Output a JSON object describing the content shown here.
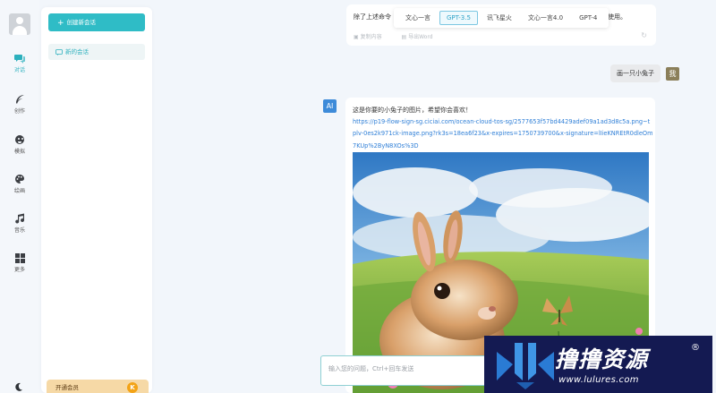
{
  "rail": {
    "items": [
      {
        "label": "对话",
        "icon": "chat-icon"
      },
      {
        "label": "创作",
        "icon": "feather-icon"
      },
      {
        "label": "模拟",
        "icon": "mask-icon"
      },
      {
        "label": "绘画",
        "icon": "palette-icon"
      },
      {
        "label": "音乐",
        "icon": "music-icon"
      },
      {
        "label": "更多",
        "icon": "grid-icon"
      }
    ],
    "active_index": 0
  },
  "sidebar": {
    "new_chat_label": "创建新会话",
    "conversations": [
      {
        "title": "新的会话"
      }
    ],
    "vip_label": "开通会员",
    "vip_badge": "K"
  },
  "chat": {
    "prev_message": {
      "text": "除了上述命令",
      "suffix": "使用。",
      "actions": [
        "复制内容",
        "导出Word"
      ]
    },
    "model_tabs": [
      "文心一言",
      "GPT-3.5",
      "讯飞星火",
      "文心一言4.0",
      "GPT-4"
    ],
    "model_selected": 1,
    "user_message": {
      "text": "画一只小兔子",
      "avatar": "我"
    },
    "ai_message": {
      "avatar": "AI",
      "intro": "这是你要的小兔子的图片，希望你会喜欢！",
      "link": "https://p19-flow-sign-sg.ciciai.com/ocean-cloud-tos-sg/2577653f57bd4429adef09a1ad3d8c5a.png~tplv-0es2k971ck-image.png?rk3s=18ea6f23&x-expires=1750739700&x-signature=lIieKNREtR0dleOm7KUp%2ByN8XOs%3D"
    },
    "input_placeholder": "输入您的问题，Ctrl+回车发送"
  },
  "watermark": {
    "title": "撸撸资源",
    "reg": "®",
    "url": "www.lulures.com"
  },
  "colors": {
    "accent": "#2fbcc6",
    "link": "#2f7fd7",
    "watermark_bg": "#141a52",
    "vip_bg": "#f6d9a6"
  }
}
